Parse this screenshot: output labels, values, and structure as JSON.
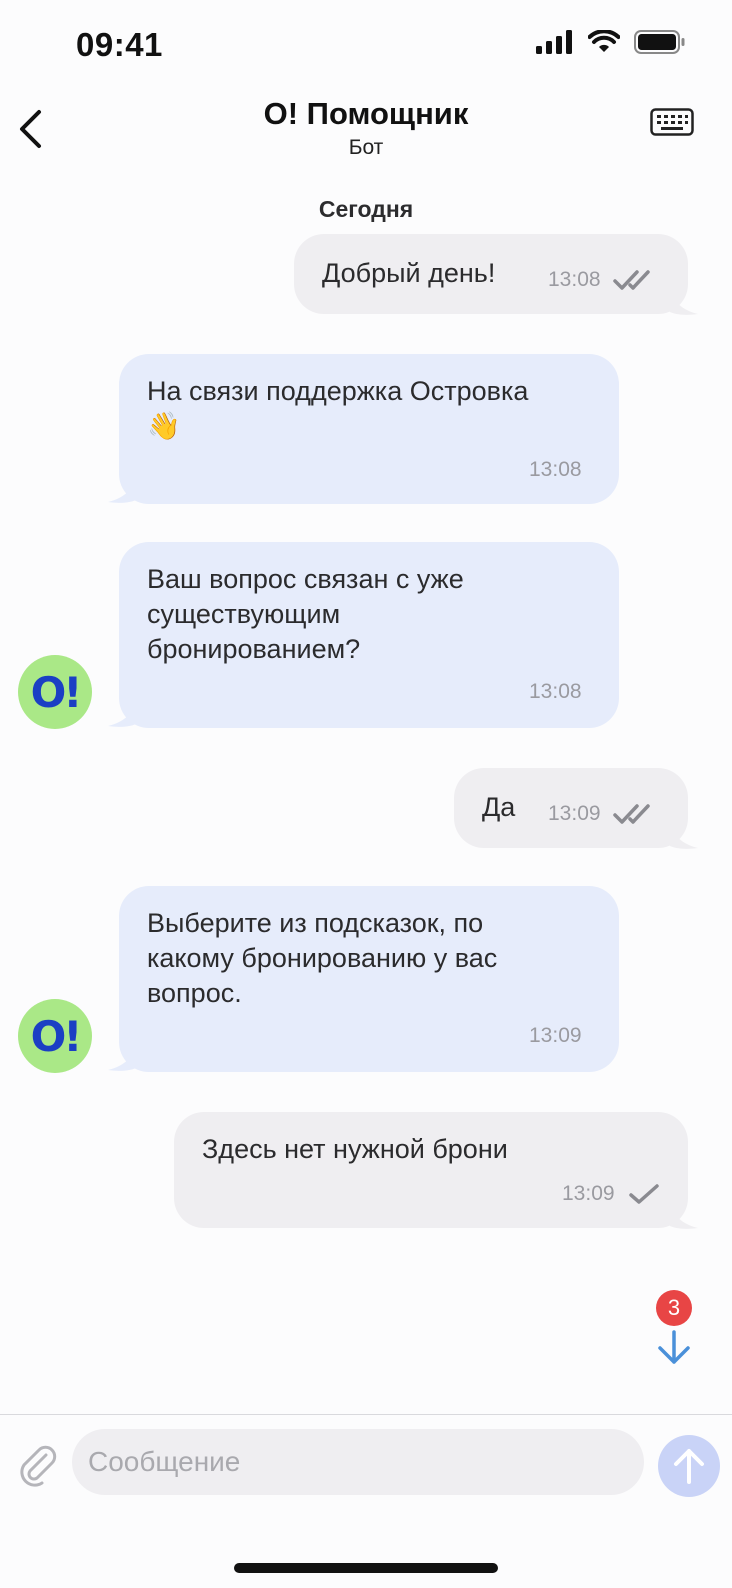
{
  "status_bar": {
    "time": "09:41"
  },
  "header": {
    "title": "О! Помощник",
    "subtitle": "Бот"
  },
  "date_separator": "Сегодня",
  "messages": [
    {
      "direction": "out",
      "text": "Добрый день!",
      "time": "13:08",
      "status": "read"
    },
    {
      "direction": "in",
      "lines": [
        "На связи поддержка Островка",
        "👋"
      ],
      "time": "13:08",
      "avatar": false
    },
    {
      "direction": "in",
      "lines": [
        "Ваш вопрос связан с уже",
        "существующим",
        "бронированием?"
      ],
      "time": "13:08",
      "avatar": true
    },
    {
      "direction": "out",
      "text": "Да",
      "time": "13:09",
      "status": "read"
    },
    {
      "direction": "in",
      "lines": [
        "Выберите из подсказок, по",
        "какому бронированию у вас",
        "вопрос."
      ],
      "time": "13:09",
      "avatar": true
    },
    {
      "direction": "out",
      "text": "Здесь нет нужной брони",
      "time": "13:09",
      "status": "sent"
    }
  ],
  "avatar_label": "O!",
  "scroll_down": {
    "unread_count": "3"
  },
  "composer": {
    "placeholder": "Сообщение"
  },
  "colors": {
    "incoming_bubble": "#e6ecfb",
    "outgoing_bubble": "#efeef1",
    "avatar_bg": "#aae887",
    "avatar_text": "#1b3fc4",
    "badge": "#e84545",
    "send_button": "#c9d3f7",
    "accent": "#4a90d9"
  },
  "icons": [
    "back-icon",
    "keyboard-icon",
    "double-check-icon",
    "check-icon",
    "arrow-down-icon",
    "paperclip-icon",
    "arrow-up-icon",
    "signal-icon",
    "wifi-icon",
    "battery-icon"
  ]
}
